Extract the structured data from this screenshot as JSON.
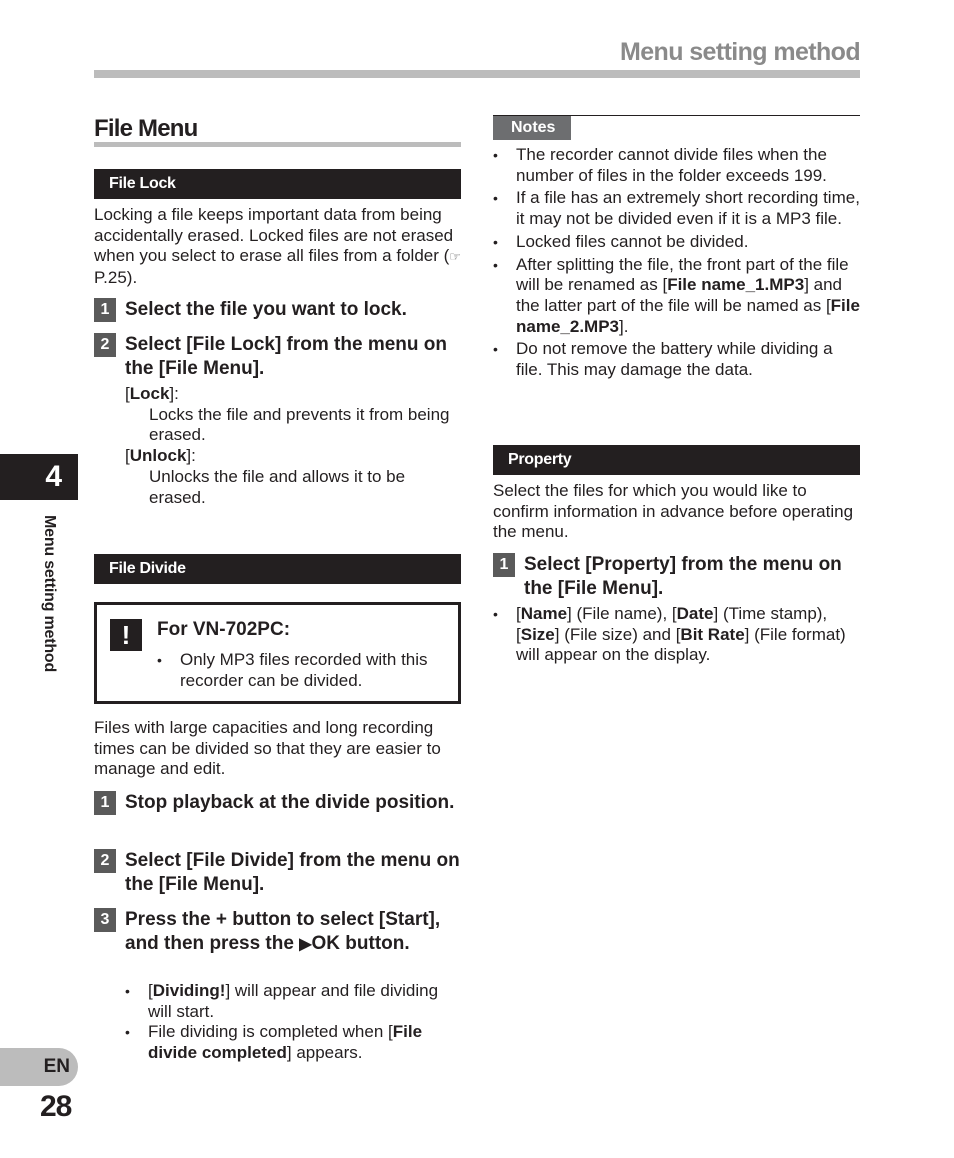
{
  "header": {
    "section_title": "Menu setting method"
  },
  "side": {
    "chapter_number": "4",
    "chapter_label": "Menu setting method",
    "language": "EN",
    "page_number": "28"
  },
  "left": {
    "title": "File Menu",
    "file_lock": {
      "heading": "File Lock",
      "intro": "Locking a file keeps important data from being accidentally erased. Locked files are not erased when you select to erase all files from a folder (",
      "ref_icon": "☞",
      "ref_text": " P.25).",
      "steps": [
        {
          "num": "1",
          "parts": [
            {
              "t": "Select the file you want to lock.",
              "b": false
            }
          ]
        },
        {
          "num": "2",
          "pre": "Select [",
          "key1": "File Lock",
          "mid": "] from the menu on the [",
          "key2": "File Menu",
          "post": "]."
        }
      ],
      "options": [
        {
          "pre": "[",
          "label": "Lock",
          "post": "]:",
          "desc": "Locks the file and prevents it from being erased."
        },
        {
          "pre": "[",
          "label": "Unlock",
          "post": "]:",
          "desc": "Unlocks the file and allows it to be erased."
        }
      ]
    },
    "file_divide": {
      "heading": "File Divide",
      "warning": {
        "icon": "!",
        "title": "For VN-702PC:",
        "bullet": "Only MP3 files recorded with this recorder can be divided."
      },
      "intro": "Files with large capacities and long recording times can be divided so that they are easier to manage and edit.",
      "step1": {
        "num": "1",
        "text": "Stop playback at the divide position."
      },
      "step2": {
        "num": "2",
        "pre": "Select [",
        "key1": "File Divide",
        "mid": "] from the menu on the [",
        "key2": "File Menu",
        "post": "]."
      },
      "step3": {
        "num": "3",
        "pre": "Press the + button to select [",
        "key1": "Start",
        "mid": "], and then press the ",
        "arrow": "▶",
        "post": "OK button."
      },
      "bullets": [
        {
          "pre": "[",
          "key": "Dividing!",
          "post": "] will appear and file dividing will start."
        },
        {
          "pre": "File dividing is completed when [",
          "key": "File divide completed",
          "post": "] appears."
        }
      ]
    }
  },
  "right": {
    "notes": {
      "label": "Notes",
      "items": [
        {
          "text": "The recorder cannot divide files when the number of files in the folder exceeds 199."
        },
        {
          "text": "If a file has an extremely short recording time, it may not be divided even if it is a MP3 file."
        },
        {
          "text": "Locked files cannot be divided."
        },
        {
          "pre": "After splitting the file, the front part of the file will be renamed as [",
          "key1": "File name_1.MP3",
          "mid": "] and the latter part of the file will be named as [",
          "key2": "File name_2.MP3",
          "post": "]."
        },
        {
          "text": "Do not remove the battery while dividing a file. This may damage the data."
        }
      ]
    },
    "property": {
      "heading": "Property",
      "intro": "Select the files for which you would like to confirm information in advance before operating the menu.",
      "step1": {
        "num": "1",
        "pre": "Select [",
        "key1": "Property",
        "mid": "] from the menu on the [",
        "key2": "File Menu",
        "post": "]."
      },
      "bullet": {
        "p1": "[",
        "k1": "Name",
        "p2": "] (File name), [",
        "k2": "Date",
        "p3": "] (Time stamp), [",
        "k3": "Size",
        "p4": "] (File size) and [",
        "k4": "Bit Rate",
        "p5": "] (File format) will appear on the display."
      }
    }
  }
}
